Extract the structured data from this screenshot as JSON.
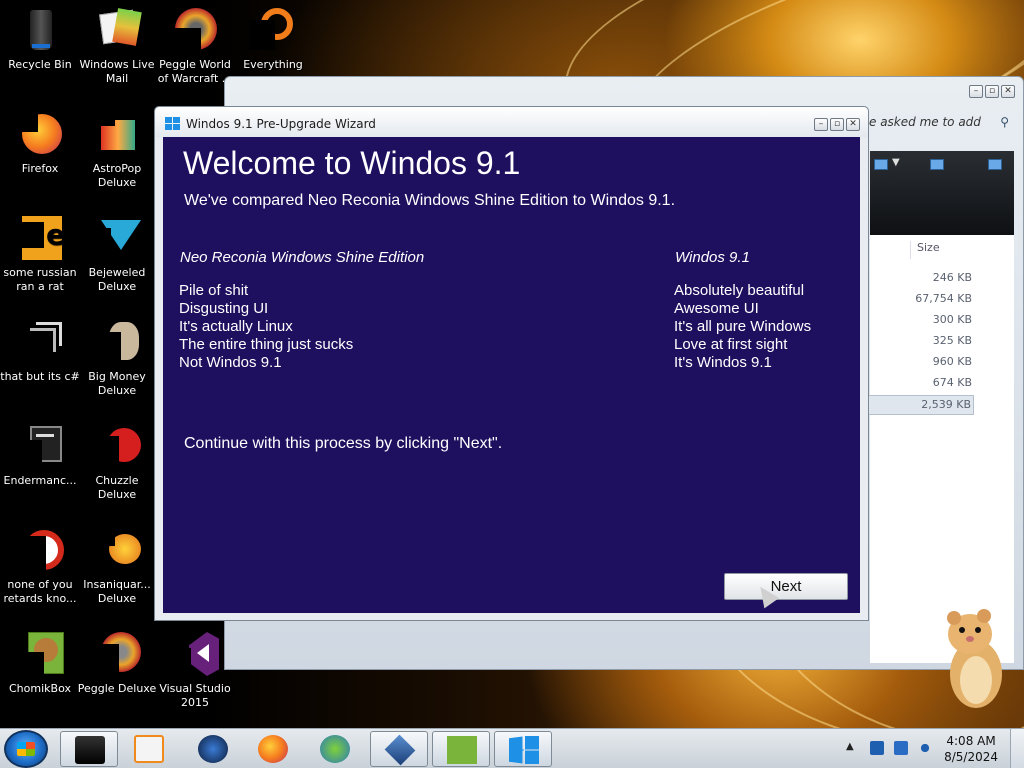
{
  "desktop": {
    "icons": [
      {
        "label": "Recycle Bin"
      },
      {
        "label": "Windows Live Mail"
      },
      {
        "label": "Peggle World of Warcraft ..."
      },
      {
        "label": "Everything"
      },
      {
        "label": "Firefox"
      },
      {
        "label": "AstroPop Deluxe"
      },
      {
        "label": "some russian ran a rat"
      },
      {
        "label": "Bejeweled Deluxe"
      },
      {
        "label": "that but its c#"
      },
      {
        "label": "Big Money Deluxe"
      },
      {
        "label": "Endermanc..."
      },
      {
        "label": "Chuzzle Deluxe"
      },
      {
        "label": "none of you retards kno..."
      },
      {
        "label": "Insaniquar... Deluxe"
      },
      {
        "label": "ChomikBox"
      },
      {
        "label": "Peggle Deluxe"
      },
      {
        "label": "Visual Studio 2015"
      }
    ]
  },
  "explorer": {
    "search_placeholder": "e asked me to add",
    "size_header": "Size",
    "sizes": [
      "246 KB",
      "67,754 KB",
      "300 KB",
      "325 KB",
      "960 KB",
      "674 KB",
      "2,539 KB"
    ]
  },
  "wizard": {
    "title": "Windos 9.1 Pre-Upgrade Wizard",
    "heading": "Welcome to Windos 9.1",
    "subtitle": "We've compared Neo Reconia Windows Shine Edition  to Windos 9.1.",
    "left_header": "Neo Reconia Windows Shine Edition",
    "right_header": "Windos 9.1",
    "left_items": [
      "Pile of shit",
      "Disgusting UI",
      "It's actually Linux",
      "The entire thing just sucks",
      "Not Windos 9.1"
    ],
    "right_items": [
      "Absolutely beautiful",
      "Awesome UI",
      "It's all pure Windows",
      "Love at first sight",
      "It's Windos 9.1"
    ],
    "continue_text": "Continue with this process by clicking \"Next\".",
    "next_label": "Next"
  },
  "taskbar": {
    "time": "4:08 AM",
    "date": "8/5/2024"
  },
  "colors": {
    "wizard_bg": "#1f0f5f",
    "accent": "#1e90e6"
  }
}
